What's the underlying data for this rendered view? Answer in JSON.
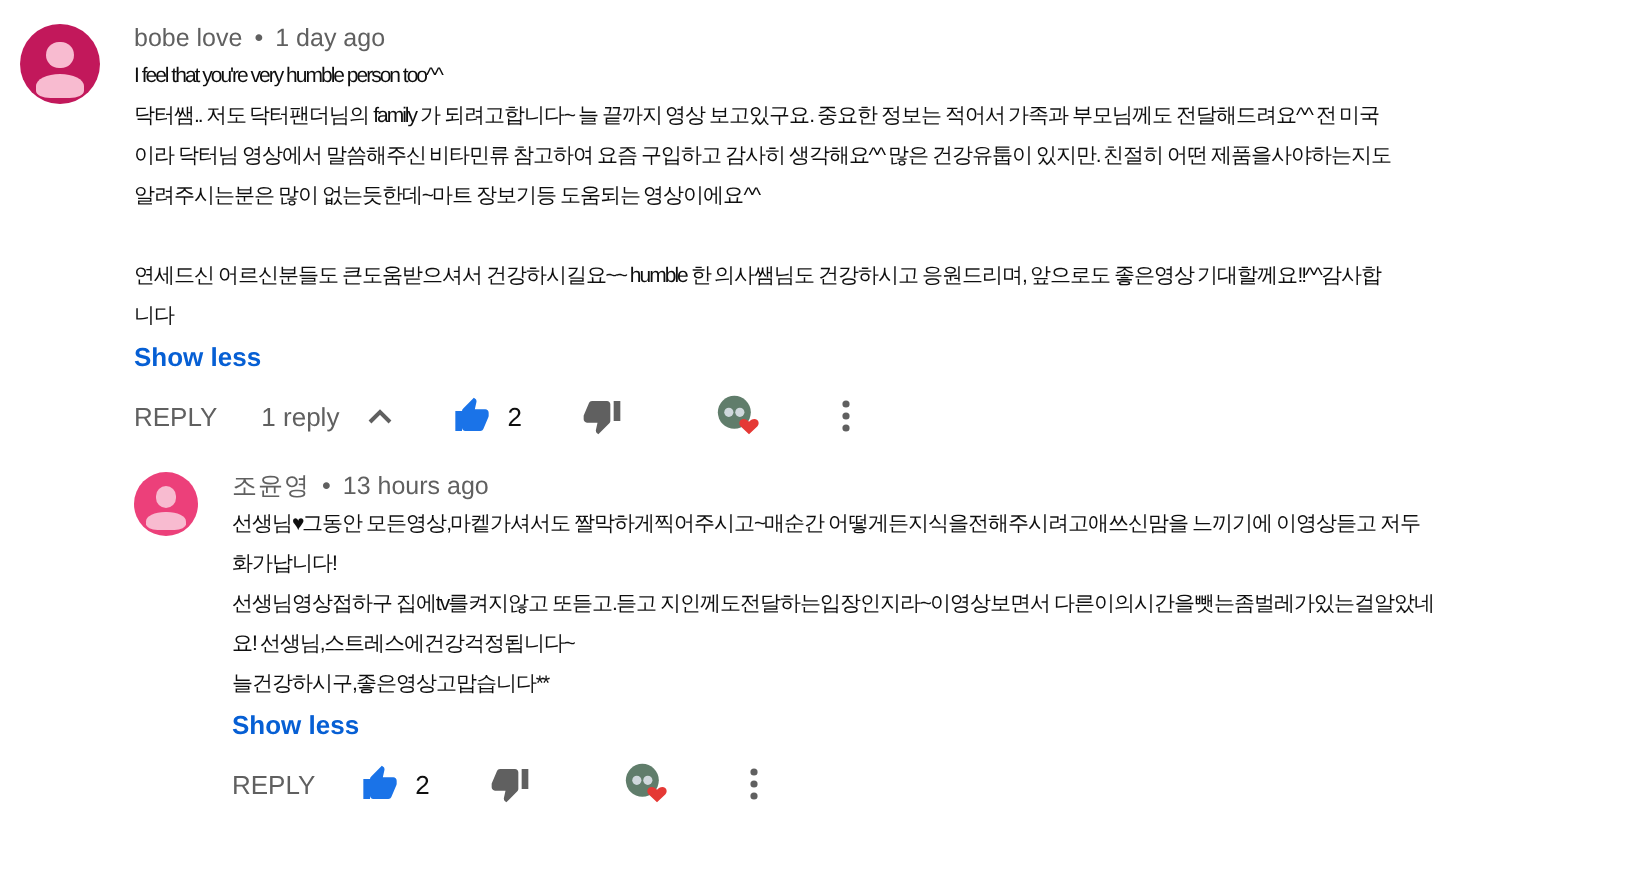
{
  "comments": [
    {
      "author": "bobe love",
      "separator": "•",
      "time": "1 day ago",
      "paragraphs": [
        [
          "I feel that you're very humble person too^^",
          "닥터쌤.. 저도 닥터팬더님의 family 가 되려고합니다~ 늘 끝까지 영상 보고있구요. 중요한 정보는 적어서 가족과 부모님께도 전달해드려요^^ 전 미국",
          "이라 닥터님 영상에서 말씀해주신 비타민류 참고하여 요즘 구입하고 감사히 생각해요^^ 많은 건강유툽이 있지만.  친절히 어떤 제품을사야하는지도",
          "알려주시는분은 많이 없는듯한데~마트 장보기등 도움되는 영상이에요^^"
        ],
        [
          "연세드신 어르신분들도 큰도움받으셔서 건강하시길요~~  humble 한 의사쌤님도 건강하시고 응원드리며, 앞으로도 좋은영상 기대할께요!!^^감사합",
          "니다"
        ]
      ],
      "show_less": "Show less",
      "reply": "REPLY",
      "replies_label": "1 reply",
      "replies_expanded": true,
      "liked": true,
      "likes": "2",
      "hearted": true,
      "replies": [
        {
          "author": "조윤영",
          "separator": "•",
          "time": "13 hours ago",
          "paragraphs": [
            [
              "선생님♥그동안 모든영상,마켙가셔서도 짤막하게찍어주시고~매순간 어떻게든지식을전해주시려고애쓰신맘을 느끼기에 이영상듣고 저두",
              "화가납니다!",
              "선생님영상접하구 집에tv를켜지않고 또듣고.듣고 지인께도전달하는입장인지라~이영상보면서 다른이의시간을뺏는좀벌레가있는걸알았네",
              "요! 선생님,스트레스에건강걱정됩니다~",
              "늘건강하시구,좋은영상고맙습니다**"
            ]
          ],
          "show_less": "Show less",
          "reply": "REPLY",
          "liked": true,
          "likes": "2",
          "hearted": true
        }
      ]
    }
  ]
}
